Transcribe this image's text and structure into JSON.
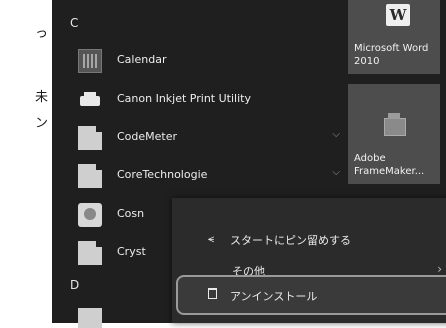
{
  "margin_text": [
    "っ",
    "未",
    "ン"
  ],
  "start_menu": {
    "headers": {
      "c": "C",
      "d": "D"
    },
    "apps": [
      {
        "label": "Calendar",
        "icon": "calendar-icon",
        "expandable": false
      },
      {
        "label": "Canon Inkjet Print Utility",
        "icon": "printer-icon",
        "expandable": false
      },
      {
        "label": "CodeMeter",
        "icon": "folder-icon",
        "expandable": true
      },
      {
        "label": "CoreTechnologie",
        "icon": "folder-icon",
        "expandable": true
      },
      {
        "label": "Cosn",
        "icon": "app-icon",
        "expandable": false
      },
      {
        "label": "Cryst",
        "icon": "folder-icon",
        "expandable": false
      }
    ]
  },
  "tiles": [
    {
      "label": "Microsoft Word 2010",
      "logo": "W"
    },
    {
      "label": "Adobe FrameMaker..."
    }
  ],
  "context_menu": {
    "pin_label": "スタートにピン留めする",
    "more_label": "その他",
    "uninstall_label": "アンインストール"
  },
  "colors": {
    "menu_bg": "#1f1f1f",
    "tile_bg": "#4d4d4d",
    "context_bg": "#2b2b2b",
    "highlight_border": "#9a9a9a"
  }
}
